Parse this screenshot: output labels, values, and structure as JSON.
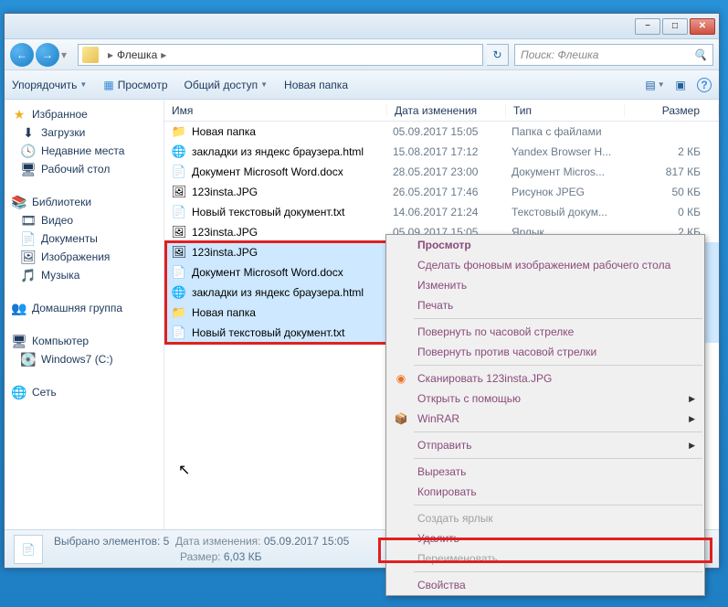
{
  "window": {
    "min_label": "−",
    "max_label": "□",
    "close_label": "✕"
  },
  "nav": {
    "back_arrow": "←",
    "fwd_arrow": "→",
    "path_root": "▸",
    "path_folder": "Флешка",
    "path_sep": "▸",
    "refresh": "↻",
    "search_placeholder": "Поиск: Флешка"
  },
  "toolbar": {
    "organize": "Упорядочить",
    "preview": "Просмотр",
    "share": "Общий доступ",
    "new_folder": "Новая папка",
    "view_icon": "▤",
    "preview_icon": "▣",
    "help_icon": "?"
  },
  "columns": {
    "name": "Имя",
    "date": "Дата изменения",
    "type": "Тип",
    "size": "Размер"
  },
  "sidebar": {
    "fav_header": "Избранное",
    "fav_items": [
      "Загрузки",
      "Недавние места",
      "Рабочий стол"
    ],
    "lib_header": "Библиотеки",
    "lib_items": [
      "Видео",
      "Документы",
      "Изображения",
      "Музыка"
    ],
    "home_header": "Домашняя группа",
    "comp_header": "Компьютер",
    "comp_items": [
      "Windows7 (C:)"
    ],
    "net_header": "Сеть"
  },
  "files": {
    "unsel": [
      {
        "icon": "📁",
        "name": "Новая папка",
        "date": "05.09.2017 15:05",
        "type": "Папка с файлами",
        "size": ""
      },
      {
        "icon": "🌐",
        "name": "закладки из яндекс браузера.html",
        "date": "15.08.2017 17:12",
        "type": "Yandex Browser H...",
        "size": "2 КБ"
      },
      {
        "icon": "📄",
        "name": "Документ Microsoft Word.docx",
        "date": "28.05.2017 23:00",
        "type": "Документ Micros...",
        "size": "817 КБ"
      },
      {
        "icon": "🖼",
        "name": "123insta.JPG",
        "date": "26.05.2017 17:46",
        "type": "Рисунок JPEG",
        "size": "50 КБ"
      },
      {
        "icon": "📄",
        "name": "Новый текстовый документ.txt",
        "date": "14.06.2017 21:24",
        "type": "Текстовый докум...",
        "size": "0 КБ"
      },
      {
        "icon": "🖼",
        "name": "123insta.JPG",
        "date": "05.09.2017 15:05",
        "type": "Ярлык",
        "size": "2 КБ"
      }
    ],
    "sel": [
      {
        "icon": "🖼",
        "name": "123insta.JPG"
      },
      {
        "icon": "📄",
        "name": "Документ Microsoft Word.docx"
      },
      {
        "icon": "🌐",
        "name": "закладки из яндекс браузера.html"
      },
      {
        "icon": "📁",
        "name": "Новая папка"
      },
      {
        "icon": "📄",
        "name": "Новый текстовый документ.txt"
      }
    ]
  },
  "ctx": {
    "preview": "Просмотр",
    "wallpaper": "Сделать фоновым изображением рабочего стола",
    "edit": "Изменить",
    "print": "Печать",
    "rotate_cw": "Повернуть по часовой стрелке",
    "rotate_ccw": "Повернуть против часовой стрелки",
    "scan": "Сканировать 123insta.JPG",
    "open_with": "Открыть с помощью",
    "winrar": "WinRAR",
    "send_to": "Отправить",
    "cut": "Вырезать",
    "copy": "Копировать",
    "shortcut": "Создать ярлык",
    "delete": "Удалить",
    "rename": "Переименовать",
    "properties": "Свойства"
  },
  "status": {
    "count_label": "Выбрано элементов: 5",
    "date_label": "Дата изменения:",
    "date_val": "05.09.2017 15:05",
    "size_label": "Размер:",
    "size_val": "6,03 КБ"
  }
}
